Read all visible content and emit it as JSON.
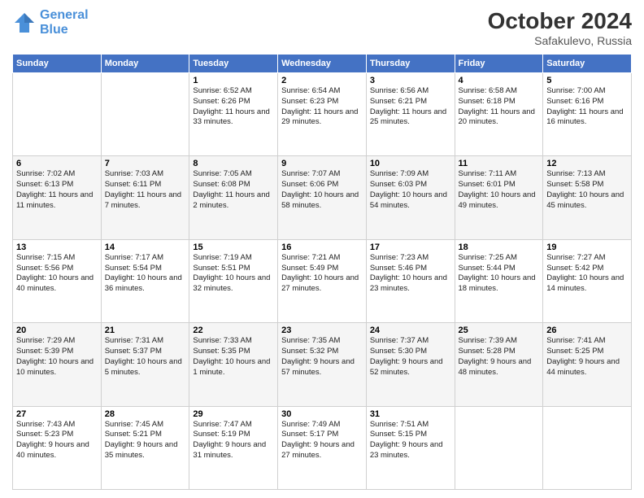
{
  "header": {
    "logo_line1": "General",
    "logo_line2": "Blue",
    "month": "October 2024",
    "location": "Safakulevo, Russia"
  },
  "weekdays": [
    "Sunday",
    "Monday",
    "Tuesday",
    "Wednesday",
    "Thursday",
    "Friday",
    "Saturday"
  ],
  "weeks": [
    [
      {
        "day": "",
        "sunrise": "",
        "sunset": "",
        "daylight": ""
      },
      {
        "day": "",
        "sunrise": "",
        "sunset": "",
        "daylight": ""
      },
      {
        "day": "1",
        "sunrise": "Sunrise: 6:52 AM",
        "sunset": "Sunset: 6:26 PM",
        "daylight": "Daylight: 11 hours and 33 minutes."
      },
      {
        "day": "2",
        "sunrise": "Sunrise: 6:54 AM",
        "sunset": "Sunset: 6:23 PM",
        "daylight": "Daylight: 11 hours and 29 minutes."
      },
      {
        "day": "3",
        "sunrise": "Sunrise: 6:56 AM",
        "sunset": "Sunset: 6:21 PM",
        "daylight": "Daylight: 11 hours and 25 minutes."
      },
      {
        "day": "4",
        "sunrise": "Sunrise: 6:58 AM",
        "sunset": "Sunset: 6:18 PM",
        "daylight": "Daylight: 11 hours and 20 minutes."
      },
      {
        "day": "5",
        "sunrise": "Sunrise: 7:00 AM",
        "sunset": "Sunset: 6:16 PM",
        "daylight": "Daylight: 11 hours and 16 minutes."
      }
    ],
    [
      {
        "day": "6",
        "sunrise": "Sunrise: 7:02 AM",
        "sunset": "Sunset: 6:13 PM",
        "daylight": "Daylight: 11 hours and 11 minutes."
      },
      {
        "day": "7",
        "sunrise": "Sunrise: 7:03 AM",
        "sunset": "Sunset: 6:11 PM",
        "daylight": "Daylight: 11 hours and 7 minutes."
      },
      {
        "day": "8",
        "sunrise": "Sunrise: 7:05 AM",
        "sunset": "Sunset: 6:08 PM",
        "daylight": "Daylight: 11 hours and 2 minutes."
      },
      {
        "day": "9",
        "sunrise": "Sunrise: 7:07 AM",
        "sunset": "Sunset: 6:06 PM",
        "daylight": "Daylight: 10 hours and 58 minutes."
      },
      {
        "day": "10",
        "sunrise": "Sunrise: 7:09 AM",
        "sunset": "Sunset: 6:03 PM",
        "daylight": "Daylight: 10 hours and 54 minutes."
      },
      {
        "day": "11",
        "sunrise": "Sunrise: 7:11 AM",
        "sunset": "Sunset: 6:01 PM",
        "daylight": "Daylight: 10 hours and 49 minutes."
      },
      {
        "day": "12",
        "sunrise": "Sunrise: 7:13 AM",
        "sunset": "Sunset: 5:58 PM",
        "daylight": "Daylight: 10 hours and 45 minutes."
      }
    ],
    [
      {
        "day": "13",
        "sunrise": "Sunrise: 7:15 AM",
        "sunset": "Sunset: 5:56 PM",
        "daylight": "Daylight: 10 hours and 40 minutes."
      },
      {
        "day": "14",
        "sunrise": "Sunrise: 7:17 AM",
        "sunset": "Sunset: 5:54 PM",
        "daylight": "Daylight: 10 hours and 36 minutes."
      },
      {
        "day": "15",
        "sunrise": "Sunrise: 7:19 AM",
        "sunset": "Sunset: 5:51 PM",
        "daylight": "Daylight: 10 hours and 32 minutes."
      },
      {
        "day": "16",
        "sunrise": "Sunrise: 7:21 AM",
        "sunset": "Sunset: 5:49 PM",
        "daylight": "Daylight: 10 hours and 27 minutes."
      },
      {
        "day": "17",
        "sunrise": "Sunrise: 7:23 AM",
        "sunset": "Sunset: 5:46 PM",
        "daylight": "Daylight: 10 hours and 23 minutes."
      },
      {
        "day": "18",
        "sunrise": "Sunrise: 7:25 AM",
        "sunset": "Sunset: 5:44 PM",
        "daylight": "Daylight: 10 hours and 18 minutes."
      },
      {
        "day": "19",
        "sunrise": "Sunrise: 7:27 AM",
        "sunset": "Sunset: 5:42 PM",
        "daylight": "Daylight: 10 hours and 14 minutes."
      }
    ],
    [
      {
        "day": "20",
        "sunrise": "Sunrise: 7:29 AM",
        "sunset": "Sunset: 5:39 PM",
        "daylight": "Daylight: 10 hours and 10 minutes."
      },
      {
        "day": "21",
        "sunrise": "Sunrise: 7:31 AM",
        "sunset": "Sunset: 5:37 PM",
        "daylight": "Daylight: 10 hours and 5 minutes."
      },
      {
        "day": "22",
        "sunrise": "Sunrise: 7:33 AM",
        "sunset": "Sunset: 5:35 PM",
        "daylight": "Daylight: 10 hours and 1 minute."
      },
      {
        "day": "23",
        "sunrise": "Sunrise: 7:35 AM",
        "sunset": "Sunset: 5:32 PM",
        "daylight": "Daylight: 9 hours and 57 minutes."
      },
      {
        "day": "24",
        "sunrise": "Sunrise: 7:37 AM",
        "sunset": "Sunset: 5:30 PM",
        "daylight": "Daylight: 9 hours and 52 minutes."
      },
      {
        "day": "25",
        "sunrise": "Sunrise: 7:39 AM",
        "sunset": "Sunset: 5:28 PM",
        "daylight": "Daylight: 9 hours and 48 minutes."
      },
      {
        "day": "26",
        "sunrise": "Sunrise: 7:41 AM",
        "sunset": "Sunset: 5:25 PM",
        "daylight": "Daylight: 9 hours and 44 minutes."
      }
    ],
    [
      {
        "day": "27",
        "sunrise": "Sunrise: 7:43 AM",
        "sunset": "Sunset: 5:23 PM",
        "daylight": "Daylight: 9 hours and 40 minutes."
      },
      {
        "day": "28",
        "sunrise": "Sunrise: 7:45 AM",
        "sunset": "Sunset: 5:21 PM",
        "daylight": "Daylight: 9 hours and 35 minutes."
      },
      {
        "day": "29",
        "sunrise": "Sunrise: 7:47 AM",
        "sunset": "Sunset: 5:19 PM",
        "daylight": "Daylight: 9 hours and 31 minutes."
      },
      {
        "day": "30",
        "sunrise": "Sunrise: 7:49 AM",
        "sunset": "Sunset: 5:17 PM",
        "daylight": "Daylight: 9 hours and 27 minutes."
      },
      {
        "day": "31",
        "sunrise": "Sunrise: 7:51 AM",
        "sunset": "Sunset: 5:15 PM",
        "daylight": "Daylight: 9 hours and 23 minutes."
      },
      {
        "day": "",
        "sunrise": "",
        "sunset": "",
        "daylight": ""
      },
      {
        "day": "",
        "sunrise": "",
        "sunset": "",
        "daylight": ""
      }
    ]
  ]
}
